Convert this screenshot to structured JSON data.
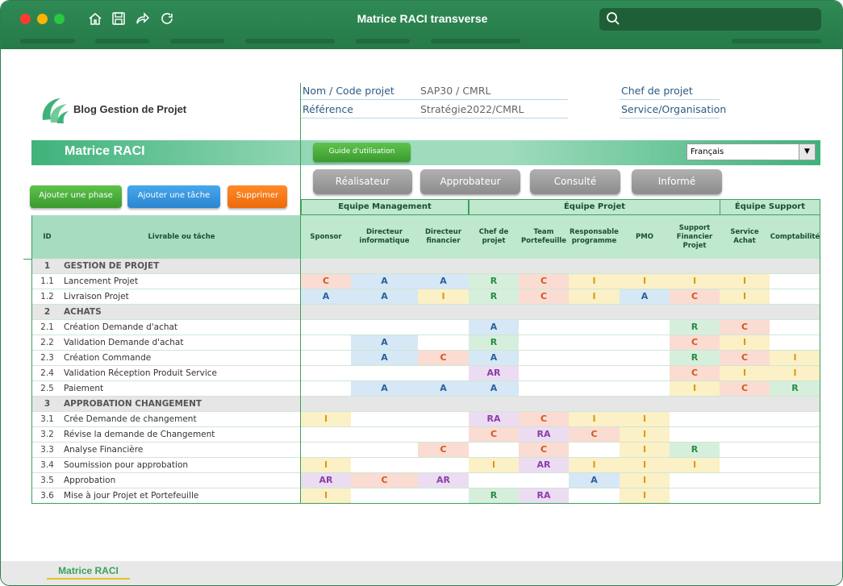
{
  "window": {
    "title": "Matrice RACI transverse"
  },
  "header": {
    "logo_text": "Blog Gestion de Projet",
    "fields": [
      {
        "label": "Nom / Code projet",
        "value": "SAP30 / CMRL"
      },
      {
        "label": "Référence",
        "value": "Stratégie2022/CMRL"
      },
      {
        "label": "Chef de projet",
        "value": ""
      },
      {
        "label": "Service/Organisation",
        "value": ""
      }
    ]
  },
  "toolbar": {
    "title": "Matrice RACI",
    "guide_label": "Guide d'utilisation",
    "language": "Français",
    "role_buttons": [
      "Réalisateur",
      "Approbateur",
      "Consulté",
      "Informé"
    ],
    "action_buttons": [
      "Ajouter une phase",
      "Ajouter une tâche",
      "Supprimer"
    ]
  },
  "table": {
    "teams": [
      "Equipe Management",
      "Équipe Projet",
      "Équipe Support"
    ],
    "id_header": "ID",
    "task_header": "Livrable ou tâche",
    "columns": [
      "Sponsor",
      "Directeur informatique",
      "Directeur financier",
      "Chef de projet",
      "Team Portefeuille",
      "Responsable programme",
      "PMO",
      "Support Financier Projet",
      "Service Achat",
      "Comptabilité"
    ],
    "rows": [
      {
        "id": "1",
        "label": "GESTION DE PROJET",
        "phase": true,
        "cells": []
      },
      {
        "id": "1.1",
        "label": "Lancement Projet",
        "cells": [
          "C",
          "A",
          "A",
          "R",
          "C",
          "I",
          "I",
          "I",
          "I",
          ""
        ]
      },
      {
        "id": "1.2",
        "label": "Livraison Projet",
        "cells": [
          "A",
          "A",
          "I",
          "R",
          "C",
          "I",
          "A",
          "C",
          "I",
          ""
        ]
      },
      {
        "id": "2",
        "label": "ACHATS",
        "phase": true,
        "cells": []
      },
      {
        "id": "2.1",
        "label": "Création Demande d'achat",
        "cells": [
          "",
          "",
          "",
          "A",
          "",
          "",
          "",
          "R",
          "C",
          ""
        ]
      },
      {
        "id": "2.2",
        "label": "Validation Demande d'achat",
        "cells": [
          "",
          "A",
          "",
          "R",
          "",
          "",
          "",
          "C",
          "I",
          ""
        ]
      },
      {
        "id": "2.3",
        "label": "Création Commande",
        "cells": [
          "",
          "A",
          "C",
          "A",
          "",
          "",
          "",
          "R",
          "C",
          "I"
        ]
      },
      {
        "id": "2.4",
        "label": "Validation Réception Produit Service",
        "cells": [
          "",
          "",
          "",
          "AR",
          "",
          "",
          "",
          "C",
          "I",
          "I"
        ]
      },
      {
        "id": "2.5",
        "label": "Paiement",
        "cells": [
          "",
          "A",
          "A",
          "A",
          "",
          "",
          "",
          "I",
          "C",
          "R"
        ]
      },
      {
        "id": "3",
        "label": "APPROBATION CHANGEMENT",
        "phase": true,
        "cells": []
      },
      {
        "id": "3.1",
        "label": "Crée Demande de changement",
        "cells": [
          "I",
          "",
          "",
          "RA",
          "C",
          "I",
          "I",
          "",
          "",
          ""
        ]
      },
      {
        "id": "3.2",
        "label": "Révise la demande de Changement",
        "cells": [
          "",
          "",
          "",
          "C",
          "RA",
          "C",
          "I",
          "",
          "",
          ""
        ]
      },
      {
        "id": "3.3",
        "label": "Analyse Financière",
        "cells": [
          "",
          "",
          "C",
          "",
          "C",
          "",
          "I",
          "R",
          "",
          ""
        ]
      },
      {
        "id": "3.4",
        "label": "Soumission pour approbation",
        "cells": [
          "I",
          "",
          "",
          "I",
          "AR",
          "I",
          "I",
          "I",
          "",
          ""
        ]
      },
      {
        "id": "3.5",
        "label": "Approbation",
        "cells": [
          "AR",
          "C",
          "AR",
          "",
          "",
          "A",
          "I",
          "",
          "",
          ""
        ]
      },
      {
        "id": "3.6",
        "label": "Mise à jour Projet et Portefeuille",
        "cells": [
          "I",
          "",
          "",
          "R",
          "RA",
          "",
          "I",
          "",
          "",
          ""
        ]
      }
    ]
  },
  "footer": {
    "sheet_tab": "Matrice RACI"
  }
}
